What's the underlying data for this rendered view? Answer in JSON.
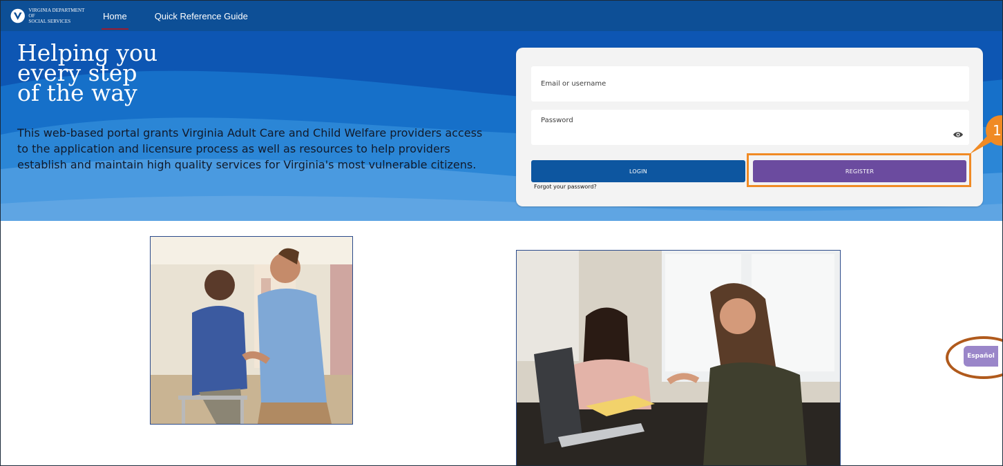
{
  "nav": {
    "logo_line1": "VIRGINIA DEPARTMENT OF",
    "logo_line2": "SOCIAL SERVICES",
    "links": [
      {
        "label": "Home",
        "active": true
      },
      {
        "label": "Quick Reference Guide",
        "active": false
      }
    ]
  },
  "hero": {
    "title_line1": "Helping you",
    "title_line2": "every step",
    "title_line3": "of the way",
    "description": "This web-based portal grants Virginia Adult Care and Child Welfare providers access to the application and licensure process as well as resources to help providers establish and maintain high quality services for Virginia's most vulnerable citizens."
  },
  "login": {
    "email_placeholder": "Email or username",
    "password_placeholder": "Password",
    "login_label": "LOGIN",
    "register_label": "REGISTER",
    "forgot_label": "Forgot your password?"
  },
  "annotation": {
    "step_number": "1",
    "highlight_color": "#f08a24",
    "ring_color": "#b05a1c"
  },
  "language": {
    "label": "Español"
  },
  "colors": {
    "nav_bg": "#0d4f96",
    "hero_bg": "#0d56b3",
    "login_btn": "#0d56a0",
    "register_btn": "#6b4b9f",
    "espanol_btn": "#9a86c9"
  },
  "images": [
    {
      "name": "caregiver-elder-photo"
    },
    {
      "name": "mentor-student-photo"
    }
  ]
}
